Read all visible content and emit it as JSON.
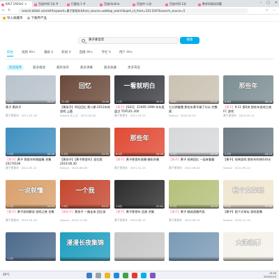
{
  "browser": {
    "tabs": [
      {
        "label": "KALT 1920x1 ×"
      },
      {
        "label": "百选中间 1次 #"
      },
      {
        "label": "行星站 1  #"
      },
      {
        "label": "百选(dul)ne"
      },
      {
        "label": "百选中 二次"
      },
      {
        "label": "百选中间 1次"
      },
      {
        "label": "数学间测试问题"
      }
    ],
    "url": "search.bilibili.com/all?keyword=黄子那首年&from_source=webtop_search&spm_id_from=333.1007&search_source=5",
    "bookmarks": [
      "导入收藏夹",
      "下载界产品"
    ]
  },
  "search": {
    "query": "黄子那首年",
    "button": "搜索"
  },
  "categories": [
    {
      "label": "综合",
      "count": ""
    },
    {
      "label": "视频",
      "count": "99+"
    },
    {
      "label": "番剧",
      "count": "0"
    },
    {
      "label": "影视",
      "count": "0"
    },
    {
      "label": "直播",
      "count": "99+"
    },
    {
      "label": "专栏",
      "count": "9"
    },
    {
      "label": "用户",
      "count": "99+"
    }
  ],
  "sorts": [
    "综合排序",
    "最多播放",
    "最新发布",
    "最多弹幕",
    "最多收藏",
    "更多筛选"
  ],
  "videos": [
    {
      "thumb_text": "",
      "color": "#b9c3cc",
      "plays": "1.1万",
      "duration": "02:37",
      "tag": "",
      "title": "黄子 黄孩子",
      "up": "黄子那首年 · 2021-03-16"
    },
    {
      "thumb_text": "回忆",
      "color": "#6b4a3a",
      "plays": "22.8万",
      "duration": "15:46",
      "tag": "",
      "title": "【黄孩子】怀旧回忆 第二期 2012年的游戏 上篇",
      "up": "Sakura-天上之 · 2024-05-03"
    },
    {
      "thumb_text": "一看就明白",
      "color": "#3b3d43",
      "plays": "1.1万",
      "duration": "09:23",
      "tag": "【黄子】",
      "title": "【S01】 E1995-1999 年年度盘点 TOP101-200",
      "up": "黄子那首年 · 2021-03-23"
    },
    {
      "thumb_text": "",
      "color": "#c9c2b2",
      "plays": "3564",
      "duration": "27:47",
      "tag": "",
      "title": "七分钟看懂 那些年黄子做了什么 完整版",
      "up": "Sakura · 2020-02-25"
    },
    {
      "thumb_text": "那些年",
      "color": "#7c8e92",
      "plays": "6.6万",
      "duration": "08:28",
      "tag": "【黄子】",
      "title": "9:11 第6关 那些年游戏之夜 FC 游戏",
      "up": "黄子那首年 · 2024-09-12"
    },
    {
      "thumb_text": "",
      "color": "#3f8fbf",
      "plays": "1.5万",
      "duration": "00:58",
      "tag": "【黄子】",
      "title": "黄子 那首年的歌曲集 合集 20170109",
      "up": "黄子那首年 · 2021-05-12"
    },
    {
      "thumb_text": "",
      "color": "#8a6d55",
      "plays": "5.1万",
      "duration": "15:30",
      "tag": "",
      "title": "【黄孩子】【黄子那首年】追忆版 2019.06.30",
      "up": "Sakura · 2022-06-08"
    },
    {
      "thumb_text": "那些年",
      "color": "#e04a34",
      "plays": "8.9万",
      "duration": "09:38",
      "tag": "【黄子】",
      "title": "黄子那首年直播 精彩合集",
      "up": "黄子那首年 · 2021-12-15"
    },
    {
      "thumb_text": "",
      "color": "#d7d8da",
      "plays": "1.2万",
      "duration": "05:29",
      "tag": "【黄子】",
      "title": "黄子 经典回忆 一起来看看",
      "up": "黄子那首年 · 2021-06-04"
    },
    {
      "thumb_text": "",
      "color": "#6f7c86",
      "plays": "2.9万",
      "duration": "04:13",
      "tag": "",
      "title": "【黄子】经典游戏 那些年的快乐时光",
      "up": "Sakura · 2021-09-12"
    },
    {
      "thumb_text": "一说就懂",
      "color": "#d9a06b",
      "plays": "2.1万",
      "duration": "04:43",
      "tag": "【黄子】",
      "title": "黄子游戏解说 游戏之夜 合集",
      "up": "黄子那首年 · 2023-05-16"
    },
    {
      "thumb_text": "一个我",
      "color": "#c4472f",
      "plays": "1.6万",
      "duration": "03:21",
      "tag": "【黄孩子】",
      "title": "黄孩子 一路走来 回忆录",
      "up": "Sakura · 2023-11-08"
    },
    {
      "thumb_text": "",
      "color": "#2c2c2c",
      "plays": "2.8万",
      "duration": "07:54",
      "tag": "【黄子】",
      "title": "黄子那首年 回放 合集",
      "up": "黄子那首年 · 2023-08-13"
    },
    {
      "thumb_text": "",
      "color": "#b5c07a",
      "plays": "5.7万",
      "duration": "12:16",
      "tag": "【黄子】",
      "title": "黄子 精选直播片段",
      "up": "黄子那首年 · 2024-06-15"
    },
    {
      "thumb_text": "租个文车玩",
      "color": "#f0e6d0",
      "plays": "9.9万",
      "duration": "03:48",
      "tag": "",
      "title": "【黄子】租个文车玩 游戏直播",
      "up": "Sakura · 2024-11-19"
    },
    {
      "thumb_text": "",
      "color": "#4c6a8c",
      "plays": "1.5万",
      "duration": "",
      "tag": "",
      "title": "",
      "up": ""
    },
    {
      "thumb_text": "漫漫长夜集锦",
      "color": "#1f9fc0",
      "plays": "",
      "duration": "",
      "tag": "",
      "title": "",
      "up": ""
    },
    {
      "thumb_text": "",
      "color": "#c8c8c8",
      "plays": "",
      "duration": "",
      "tag": "",
      "title": "",
      "up": ""
    },
    {
      "thumb_text": "",
      "color": "#7a9ab5",
      "plays": "",
      "duration": "",
      "tag": "",
      "title": "",
      "up": ""
    },
    {
      "thumb_text": "大津往事",
      "color": "#f5f1ea",
      "plays": "",
      "duration": "",
      "tag": "",
      "title": "",
      "up": ""
    }
  ],
  "taskbar": {
    "weather": "29°C",
    "time": "15:59",
    "date": "2025/1/13"
  }
}
